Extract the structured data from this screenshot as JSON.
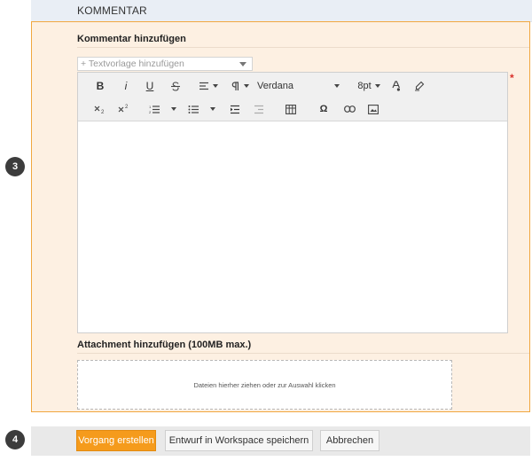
{
  "steps": {
    "comment": "3",
    "actions": "4"
  },
  "section": {
    "title": "KOMMENTAR"
  },
  "comment": {
    "label": "Kommentar hinzufügen",
    "template_placeholder": "+ Textvorlage hinzufügen",
    "required_marker": "*"
  },
  "toolbar": {
    "bold": "B",
    "italic": "i",
    "underline": "U",
    "font_name": "Verdana",
    "font_size": "8pt",
    "special_char": "Ω"
  },
  "attachment": {
    "label": "Attachment hinzufügen (100MB max.)",
    "dropzone_text": "Dateien hierher ziehen oder zur Auswahl klicken"
  },
  "actions": {
    "create": "Vorgang erstellen",
    "save_draft": "Entwurf in Workspace speichern",
    "cancel": "Abbrechen"
  },
  "colors": {
    "accent": "#f59b1c",
    "panel_bg": "#fdf0e2",
    "panel_border": "#f1a73f",
    "required": "#d9302a"
  },
  "icons": [
    "bold-icon",
    "italic-icon",
    "underline-icon",
    "strikethrough-icon",
    "align-icon",
    "paragraph-icon",
    "font-color-icon",
    "highlight-icon",
    "subscript-icon",
    "superscript-icon",
    "ordered-list-icon",
    "unordered-list-icon",
    "indent-icon",
    "outdent-icon",
    "table-icon",
    "special-char-icon",
    "link-icon",
    "image-icon"
  ]
}
